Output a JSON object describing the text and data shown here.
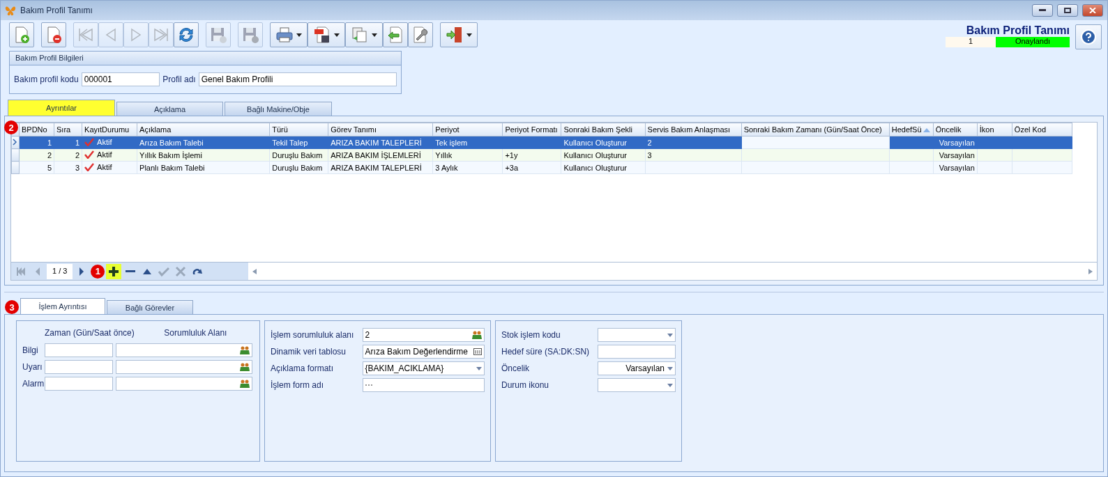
{
  "window": {
    "title": "Bakım Profil Tanımı"
  },
  "toolbar": [
    {
      "kind": "new",
      "disabled": false
    },
    {
      "kind": "delete",
      "disabled": false
    },
    {
      "kind": "first",
      "disabled": true
    },
    {
      "kind": "prev",
      "disabled": true
    },
    {
      "kind": "next",
      "disabled": true
    },
    {
      "kind": "last",
      "disabled": true
    },
    {
      "kind": "refresh",
      "disabled": false
    },
    {
      "kind": "save",
      "disabled": true
    },
    {
      "kind": "save-close",
      "disabled": true
    },
    {
      "kind": "print",
      "disabled": false,
      "dropdown": true
    },
    {
      "kind": "pdf",
      "disabled": false,
      "dropdown": true
    },
    {
      "kind": "copy",
      "disabled": false,
      "dropdown": true
    },
    {
      "kind": "import",
      "disabled": false
    },
    {
      "kind": "tools",
      "disabled": false
    },
    {
      "kind": "exit",
      "disabled": false,
      "dropdown": true
    }
  ],
  "header": {
    "title": "Bakım Profil Tanımı",
    "record": "1",
    "status": "Onaylandı"
  },
  "info": {
    "title": "Bakım Profil Bilgileri",
    "fields": [
      {
        "label": "Bakım profil kodu",
        "value": "000001"
      },
      {
        "label": "Profil adı",
        "value": "Genel Bakım Profili"
      }
    ]
  },
  "tabs": [
    {
      "label": "Ayrıntılar",
      "selected": true
    },
    {
      "label": "Açıklama",
      "selected": false
    },
    {
      "label": "Bağlı Makine/Obje",
      "selected": false
    }
  ],
  "callouts": [
    "1",
    "2",
    "3"
  ],
  "grid": {
    "columns": [
      {
        "label": "BPDNo",
        "sorted": false
      },
      {
        "label": "Sıra",
        "sorted": false
      },
      {
        "label": "KayıtDurumu",
        "sorted": false
      },
      {
        "label": "Açıklama",
        "sorted": false
      },
      {
        "label": "Türü",
        "sorted": false
      },
      {
        "label": "Görev Tanımı",
        "sorted": false
      },
      {
        "label": "Periyot",
        "sorted": false
      },
      {
        "label": "Periyot Formatı",
        "sorted": false
      },
      {
        "label": "Sonraki Bakım Şekli",
        "sorted": false
      },
      {
        "label": "Servis Bakım Anlaşması",
        "sorted": false
      },
      {
        "label": "Sonraki Bakım Zamanı (Gün/Saat Önce)",
        "sorted": false
      },
      {
        "label": "HedefSü",
        "sorted": true
      },
      {
        "label": "Öncelik",
        "sorted": false
      },
      {
        "label": "İkon",
        "sorted": false
      },
      {
        "label": "Özel Kod",
        "sorted": false
      }
    ],
    "rows": [
      {
        "selected": true,
        "cells": [
          "1",
          "1",
          "Aktif",
          "Arıza Bakım Talebi",
          "Tekil Talep",
          "ARIZA BAKIM TALEPLERİ",
          "Tek işlem",
          "",
          "Kullanıcı Oluşturur",
          "2",
          "",
          "",
          "Varsayılan",
          "",
          ""
        ]
      },
      {
        "selected": false,
        "cells": [
          "2",
          "2",
          "Aktif",
          "Yıllık Bakım İşlemi",
          "Duruşlu Bakım",
          "ARIZA BAKIM İŞLEMLERİ",
          "Yıllık",
          "+1y",
          "Kullanıcı Oluşturur",
          "3",
          "",
          "",
          "Varsayılan",
          "",
          ""
        ]
      },
      {
        "selected": false,
        "cells": [
          "5",
          "3",
          "Aktif",
          "Planlı Bakım Talebi",
          "Duruşlu Bakım",
          "ARIZA BAKIM TALEPLERİ",
          "3 Aylık",
          "+3a",
          "Kullanıcı Oluşturur",
          "",
          "",
          "",
          "Varsayılan",
          "",
          ""
        ]
      }
    ]
  },
  "navigator": {
    "position": "1 / 3",
    "buttons": [
      {
        "kind": "first",
        "disabled": true
      },
      {
        "kind": "prev",
        "disabled": true
      },
      {
        "kind": "next",
        "disabled": false
      },
      {
        "kind": "add",
        "disabled": false,
        "highlighted": true
      },
      {
        "kind": "remove",
        "disabled": false
      },
      {
        "kind": "up",
        "disabled": false
      },
      {
        "kind": "confirm",
        "disabled": true
      },
      {
        "kind": "cancel",
        "disabled": true
      },
      {
        "kind": "redo",
        "disabled": false
      }
    ]
  },
  "lower_tabs": [
    {
      "label": "İşlem Ayrıntısı",
      "selected": true
    },
    {
      "label": "Bağlı Görevler",
      "selected": false
    }
  ],
  "alerts": {
    "headers": [
      "Zaman (Gün/Saat önce)",
      "Sorumluluk Alanı"
    ],
    "rows": [
      {
        "label": "Bilgi"
      },
      {
        "label": "Uyarı"
      },
      {
        "label": "Alarm"
      }
    ]
  },
  "process": [
    {
      "label": "İşlem sorumluluk alanı",
      "value": "2",
      "kind": "lookup"
    },
    {
      "label": "Dinamik veri tablosu",
      "value": "Arıza Bakım Değerlendirme",
      "kind": "table"
    },
    {
      "label": "Açıklama formatı",
      "value": "{BAKIM_ACIKLAMA}",
      "kind": "dropdown"
    },
    {
      "label": "İşlem form adı",
      "kind": "ellipsis"
    }
  ],
  "stock": [
    {
      "label": "Stok işlem kodu",
      "kind": "dropdown"
    },
    {
      "label": "Hedef süre (SA:DK:SN)",
      "kind": "text"
    },
    {
      "label": "Öncelik",
      "value": "Varsayılan",
      "kind": "dropdown"
    },
    {
      "label": "Durum ikonu",
      "kind": "dropdown"
    }
  ]
}
